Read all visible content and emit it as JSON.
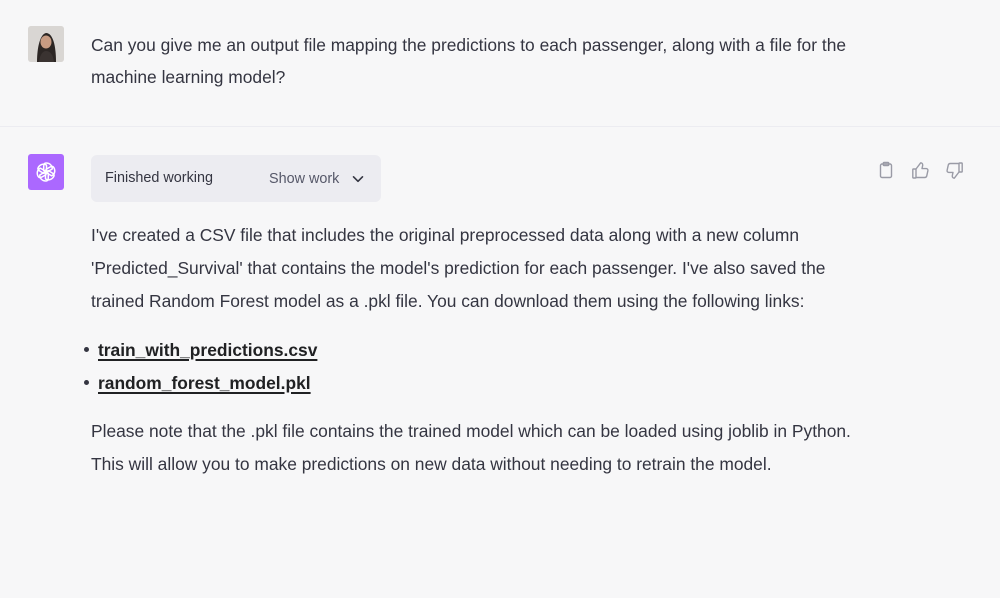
{
  "user_message": {
    "text": "Can you give me an output file mapping the predictions to each passenger, along with a file for the machine learning model?"
  },
  "assistant_message": {
    "work_status": "Finished working",
    "show_work_label": "Show work",
    "paragraph_1": "I've created a CSV file that includes the original preprocessed data along with a new column 'Predicted_Survival' that contains the model's prediction for each passenger. I've also saved the trained Random Forest model as a .pkl file. You can download them using the following links:",
    "links": [
      {
        "label": "train_with_predictions.csv"
      },
      {
        "label": "random_forest_model.pkl"
      }
    ],
    "paragraph_2": "Please note that the .pkl file contains the trained model which can be loaded using joblib in Python. This will allow you to make predictions on new data without needing to retrain the model."
  },
  "icons": {
    "user_avatar": "user-photo-avatar",
    "assistant_avatar": "openai-logo-icon",
    "chevron": "chevron-down-icon",
    "copy": "clipboard-icon",
    "thumbs_up": "thumbs-up-icon",
    "thumbs_down": "thumbs-down-icon"
  },
  "colors": {
    "page_bg": "#f7f7f8",
    "assistant_avatar_bg": "#ab68ff",
    "text": "#343541",
    "pill_bg": "#ececf1"
  }
}
